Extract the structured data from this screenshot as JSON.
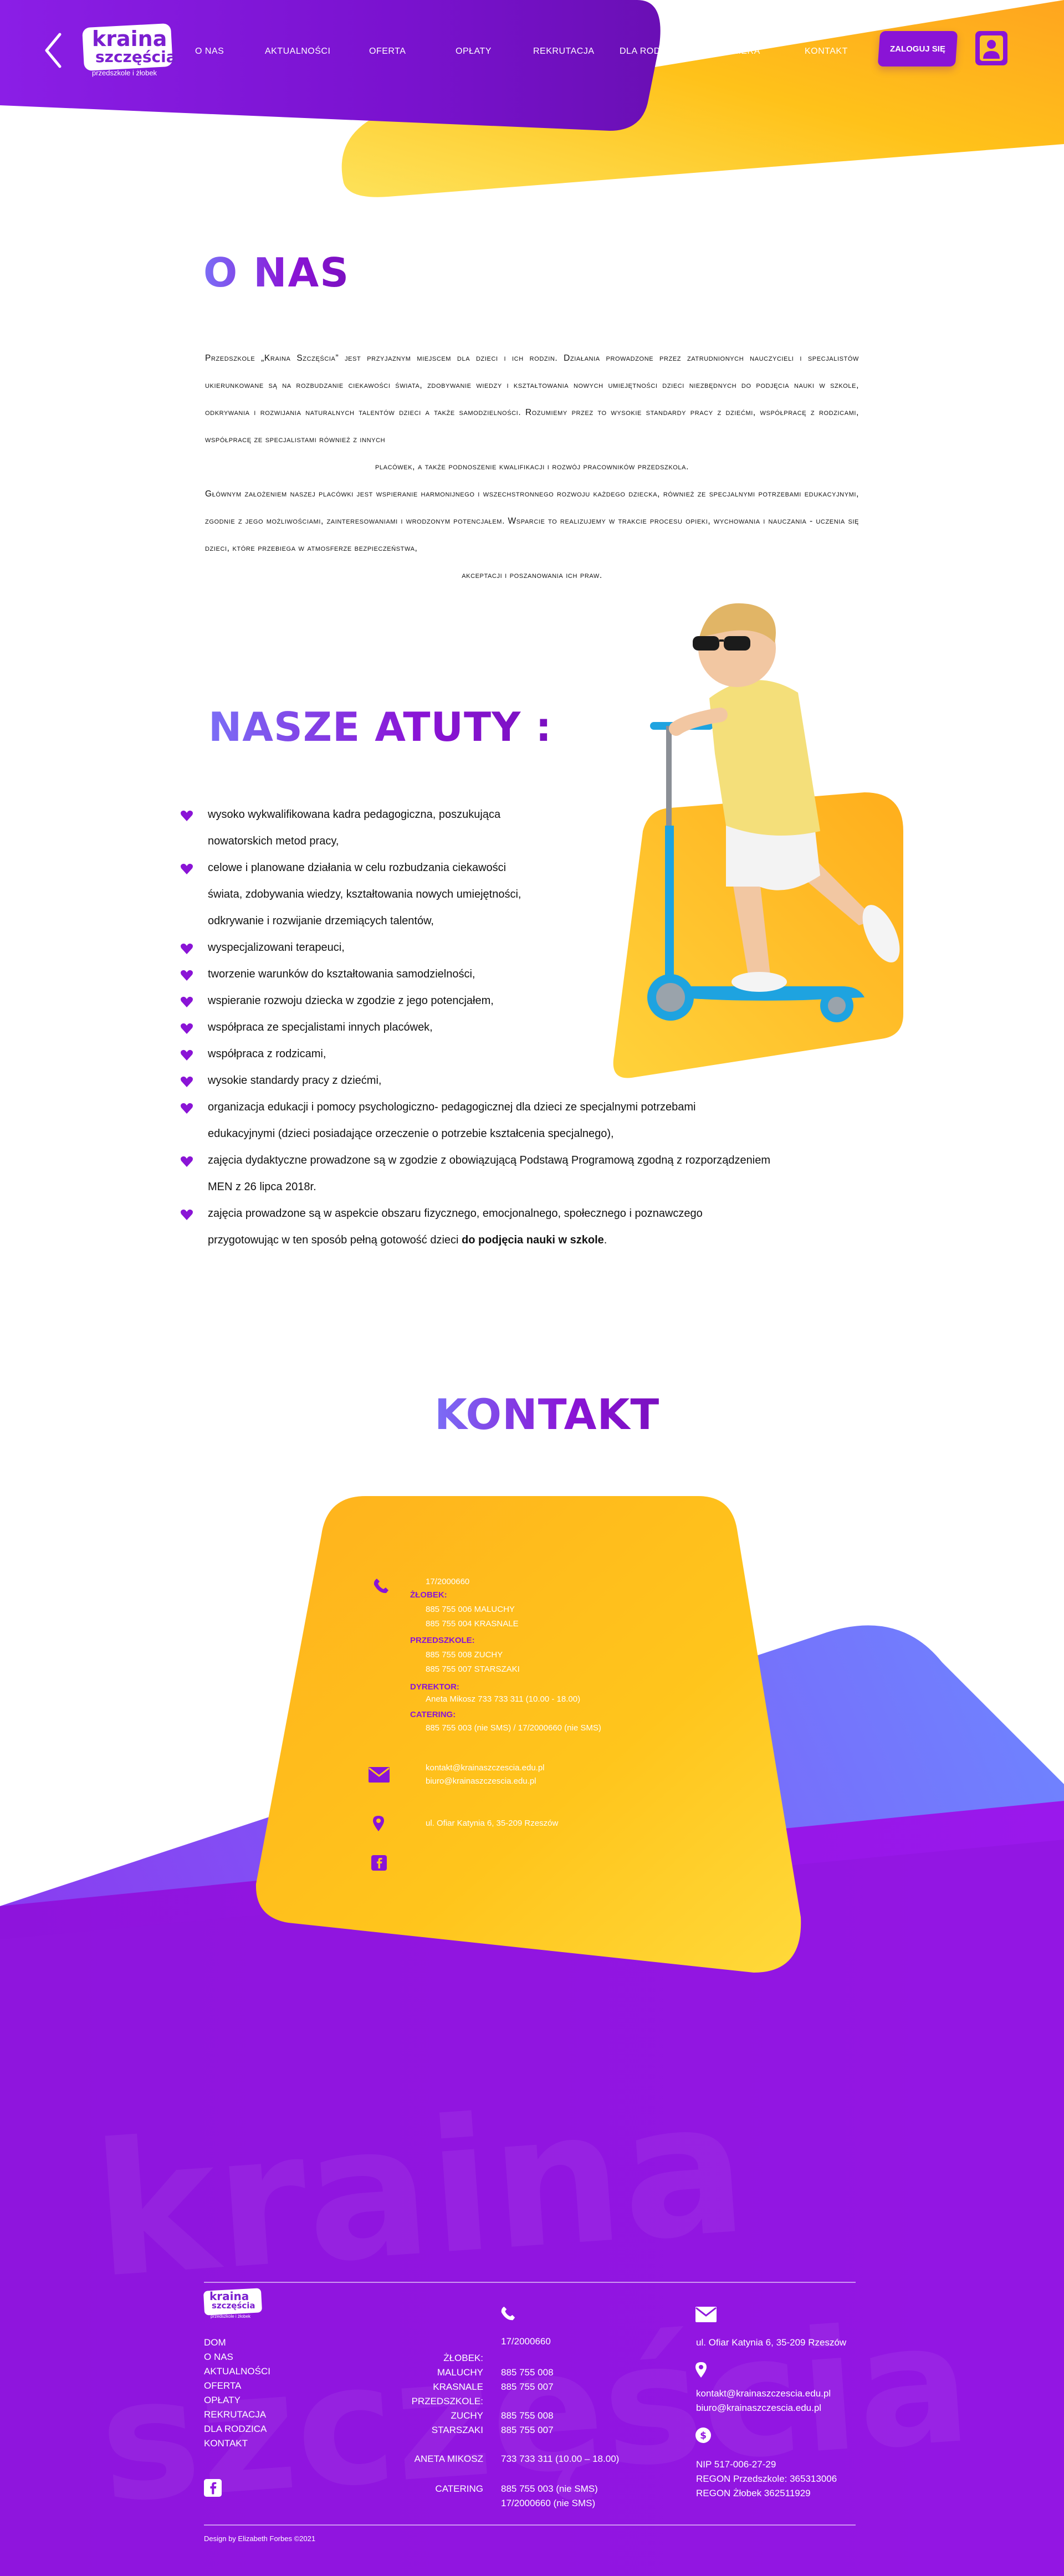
{
  "header": {
    "logo": {
      "line1": "kraina",
      "line2": "szczęścia",
      "sub": "przedszkole i żłobek"
    },
    "nav": [
      {
        "label": "O NAS"
      },
      {
        "label": "AKTUALNOŚCI"
      },
      {
        "label": "OFERTA"
      },
      {
        "label": "OPŁATY"
      },
      {
        "label": "REKRUTACJA"
      },
      {
        "label": "DLA RODZICA"
      },
      {
        "label": "KARIERA"
      },
      {
        "label": "KONTAKT"
      }
    ],
    "login_label": "ZALOGUJ SIĘ",
    "icons": {
      "back": "chevron-left-icon",
      "user": "user-icon"
    }
  },
  "onas": {
    "title": "O NAS",
    "paragraph1": "Przedszkole „Kraina Szczęścia” jest przyjaznym miejscem dla dzieci i ich rodzin. Działania prowadzone przez zatrudnionych nauczycieli i specjalistów ukierunkowane są na rozbudzanie ciekawości świata, zdobywanie wiedzy i kształtowania nowych umiejętności dzieci niezbędnych do podjęcia nauki w szkole, odkrywania i rozwijania naturalnych talentów dzieci a także samodzielności. Rozumiemy przez to wysokie standardy pracy z dziećmi, współpracę z rodzicami, współpracę ze specjalistami również z innych",
    "paragraph1_end": "placówek, a także podnoszenie kwalifikacji i rozwój pracowników przedszkola.",
    "paragraph2": "Głównym założeniem naszej placówki jest wspieranie harmonijnego i wszechstronnego rozwoju każdego dziecka, również ze specjalnymi potrzebami edukacyjnymi, zgodnie z jego możliwościami, zainteresowaniami i wrodzonym potencjałem. Wsparcie to realizujemy w trakcie procesu opieki, wychowania i nauczania - uczenia się dzieci, które przebiega w atmosferze bezpieczeństwa,",
    "paragraph2_end": "akceptacji i poszanowania ich praw."
  },
  "atuty": {
    "title": "NASZE ATUTY  :",
    "items": [
      "wysoko wykwalifikowana kadra pedagogiczna, poszukująca",
      "nowatorskich metod pracy,",
      "celowe i planowane działania w celu rozbudzania ciekawości",
      "świata, zdobywania wiedzy, kształtowania nowych umiejętności,",
      "odkrywanie i rozwijanie drzemiących talentów,",
      "wyspecjalizowani terapeuci,",
      "tworzenie warunków do kształtowania samodzielności,",
      "wspieranie rozwoju dziecka w zgodzie z jego potencjałem,",
      "współpraca ze specjalistami innych placówek,",
      "współpraca z rodzicami,",
      "wysokie standardy pracy z dziećmi,",
      "organizacja edukacji i pomocy psychologiczno- pedagogicznej dla dzieci ze specjalnymi potrzebami",
      "edukacyjnymi (dzieci posiadające orzeczenie o potrzebie kształcenia specjalnego),",
      "zajęcia dydaktyczne prowadzone są w zgodzie z obowiązującą Podstawą Programową zgodną z rozporządzeniem",
      "MEN z 26 lipca 2018r.",
      "zajęcia prowadzone są w aspekcie obszaru fizycznego, emocjonalnego, społecznego i poznawczego",
      "przygotowując w ten sposób pełną gotowość dzieci "
    ],
    "last_bold": "do podjęcia nauki w szkole",
    "last_end": "."
  },
  "kontakt": {
    "title": "KONTAKT",
    "card": {
      "phone_main": "17/2000660",
      "zlobek_label": "ŻŁOBEK:",
      "zlobek_1": "885 755 006  MALUCHY",
      "zlobek_2": "885 755 004  KRASNALE",
      "przedszkole_label": "PRZEDSZKOLE:",
      "przedszkole_1": "885 755 008 ZUCHY",
      "przedszkole_2": "885 755 007 STARSZAKI",
      "dyrektor_label": "DYREKTOR:",
      "dyrektor_value": "Aneta Mikosz 733 733 311 (10.00 - 18.00)",
      "catering_label": "CATERING:",
      "catering_value": "885 755 003 (nie SMS) / 17/2000660 (nie SMS)",
      "email_1": "kontakt@krainaszczescia.edu.pl",
      "email_2": "biuro@krainaszczescia.edu.pl",
      "address": "ul. Ofiar Katynia 6, 35-209 Rzeszów"
    }
  },
  "footer": {
    "menu": [
      "DOM",
      "O NAS",
      "AKTUALNOŚCI",
      "OFERTA",
      "OPŁATY",
      "REKRUTACJA",
      "DLA RODZICA",
      "KONTAKT"
    ],
    "phone_main": "17/2000660",
    "zlobek_label": "ŻŁOBEK:",
    "maluchy_label": "MALUCHY",
    "maluchy_value": "885 755 008",
    "krasnale_label": "KRASNALE",
    "krasnale_value": "885 755 007",
    "przedszkole_label": "PRZEDSZKOLE:",
    "zuchy_label": "ZUCHY",
    "zuchy_value": "885 755 008",
    "starszaki_label": "STARSZAKI",
    "starszaki_value": "885 755 007",
    "aneta_label": "ANETA MIKOSZ",
    "aneta_value": "733 733 311 (10.00 – 18.00)",
    "catering_label": "CATERING",
    "catering_value1": "885 755 003 (nie SMS)",
    "catering_value2": "17/2000660 (nie SMS)",
    "address": "ul. Ofiar Katynia 6, 35-209 Rzeszów",
    "email_1": "kontakt@krainaszczescia.edu.pl",
    "email_2": "biuro@krainaszczescia.edu.pl",
    "nip": "NIP 517-006-27-29",
    "regon1": "REGON Przedszkole: 365313006",
    "regon2": "REGON Żłobek 362511929",
    "credit": "Design by Elizabeth Forbes ©2021"
  }
}
